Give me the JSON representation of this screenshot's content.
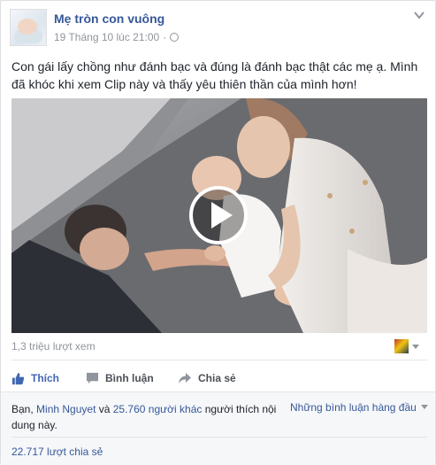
{
  "post": {
    "page_name": "Mẹ tròn con vuông",
    "timestamp": "19 Tháng 10 lúc 21:00",
    "separator": "·",
    "privacy_icon": "globe-icon",
    "text": "Con gái lấy chồng như đánh bạc và đúng là đánh bạc thật các mẹ ạ. Mình đã khóc khi xem Clip này và thấy yêu thiên thần của mình hơn!"
  },
  "video": {
    "views": "1,3 triệu lượt xem",
    "play_icon": "play-icon"
  },
  "actions": {
    "like_label": "Thích",
    "comment_label": "Bình luận",
    "share_label": "Chia sẻ"
  },
  "likes": {
    "prefix": "Bạn, ",
    "name": "Minh Nguyet",
    "middle": " và ",
    "others": "25.760 người khác",
    "suffix": " người thích nội dung này."
  },
  "comments_sort": "Những bình luận hàng đầu",
  "shares": "22.717 lượt chia sẻ",
  "colors": {
    "link": "#365899",
    "like_active": "#4267b2",
    "meta": "#90949c"
  }
}
